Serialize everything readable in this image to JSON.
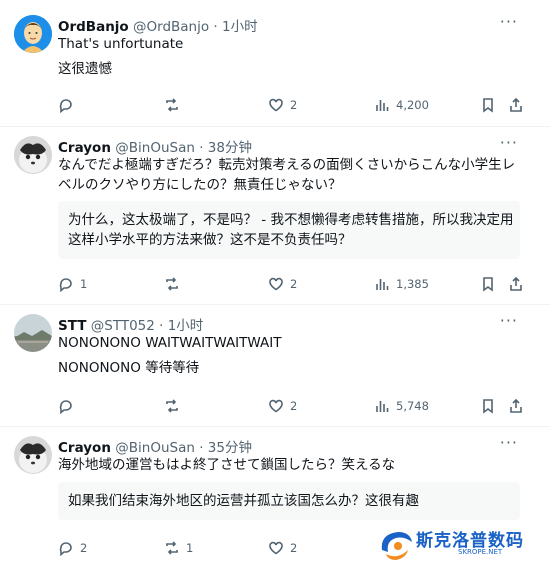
{
  "posts": [
    {
      "name": "OrdBanjo",
      "handle": "@OrdBanjo",
      "time": "· 1小时",
      "text": [
        "That's unfortunate",
        "这很遗憾"
      ],
      "translation": [],
      "stats": {
        "reply": "",
        "repost": "",
        "like": "2",
        "views": "4,200"
      }
    },
    {
      "name": "Crayon",
      "handle": "@BinOuSan",
      "time": "· 38分钟",
      "text": [
        "なんでだよ極端すぎだろ？転売対策考えるの面倒くさいからこんな小学生レ",
        "ベルのクソやり方にしたの？無責任じゃない？"
      ],
      "translation": [
        "为什么，这太极端了，不是吗？ - 我不想懒得考虑转售措施，所以我决定用",
        "这样小学水平的方法来做？这不是不负责任吗？"
      ],
      "stats": {
        "reply": "1",
        "repost": "",
        "like": "2",
        "views": "1,385"
      }
    },
    {
      "name": "STT",
      "handle": "@STT052",
      "time": "· 1小时",
      "text": [
        "NONONONO WAITWAITWAITWAIT",
        "NONONONO 等待等待"
      ],
      "translation": [],
      "stats": {
        "reply": "",
        "repost": "",
        "like": "2",
        "views": "5,748"
      }
    },
    {
      "name": "Crayon",
      "handle": "@BinOuSan",
      "time": "· 35分钟",
      "text": [
        "海外地域の運営もはよ終了させて鎖国したら？笑えるな"
      ],
      "translation": [
        "如果我们结束海外地区的运营并孤立该国怎么办？这很有趣"
      ],
      "stats": {
        "reply": "2",
        "repost": "1",
        "like": "2",
        "views": ""
      }
    }
  ],
  "more_label": "···",
  "watermark": {
    "title": "斯克洛普数码",
    "sub": "SKROPE.NET",
    "color": "#1b62c6"
  }
}
